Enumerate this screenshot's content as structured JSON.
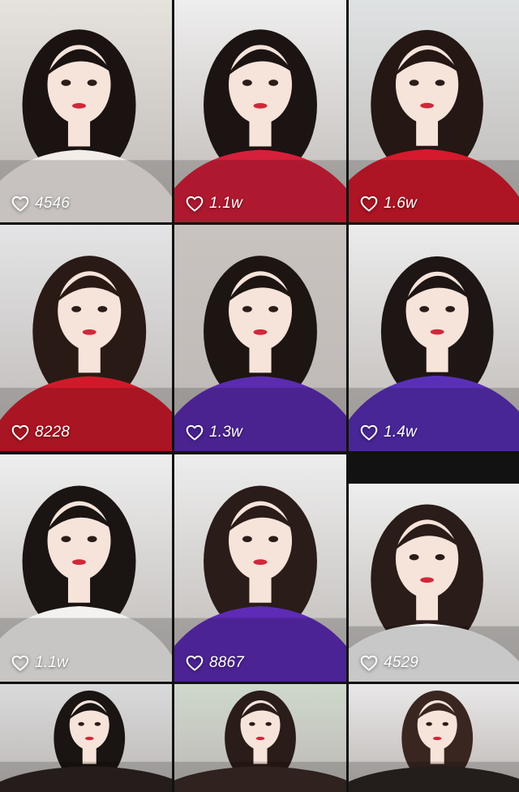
{
  "feed": {
    "tiles": [
      {
        "likes": "4546",
        "bg": "#e6e2dc",
        "shirt": "#f3ede9",
        "hair": "#1a1312"
      },
      {
        "likes": "1.1w",
        "bg": "#efeeee",
        "shirt": "#d61f3a",
        "hair": "#1c1413"
      },
      {
        "likes": "1.6w",
        "bg": "#dfe2e3",
        "shirt": "#d41a2c",
        "hair": "#241714"
      },
      {
        "likes": "8228",
        "bg": "#e4e4e6",
        "shirt": "#d01a2b",
        "hair": "#2a1a16"
      },
      {
        "likes": "1.3w",
        "bg": "#c9c3c0",
        "shirt": "#5b2bb0",
        "hair": "#1d1512"
      },
      {
        "likes": "1.4w",
        "bg": "#ececec",
        "shirt": "#5a2fb8",
        "hair": "#1e1614"
      },
      {
        "likes": "1.1w",
        "bg": "#eeeeee",
        "shirt": "#f4f2f0",
        "hair": "#1a1412"
      },
      {
        "likes": "8867",
        "bg": "#ededed",
        "shirt": "#5d2bb5",
        "hair": "#2a1c18"
      },
      {
        "likes": "4529",
        "bg": "#eeeeee",
        "shirt": "#f5f5f5",
        "hair": "#2a1c18"
      },
      {
        "likes": "",
        "bg": "#d9dadb",
        "shirt": "#2c2422",
        "hair": "#1a1412"
      },
      {
        "likes": "",
        "bg": "#cfd9cc",
        "shirt": "#3a2a26",
        "hair": "#2a1c18"
      },
      {
        "likes": "",
        "bg": "#e9e8e8",
        "shirt": "#2b2423",
        "hair": "#3a2620"
      }
    ],
    "colors": {
      "gutter": "#121212",
      "skin": "#f6e3da",
      "lips": "#d0283a",
      "overlay_text": "#ffffff"
    },
    "icons": {
      "like": "heart-outline-icon"
    }
  }
}
